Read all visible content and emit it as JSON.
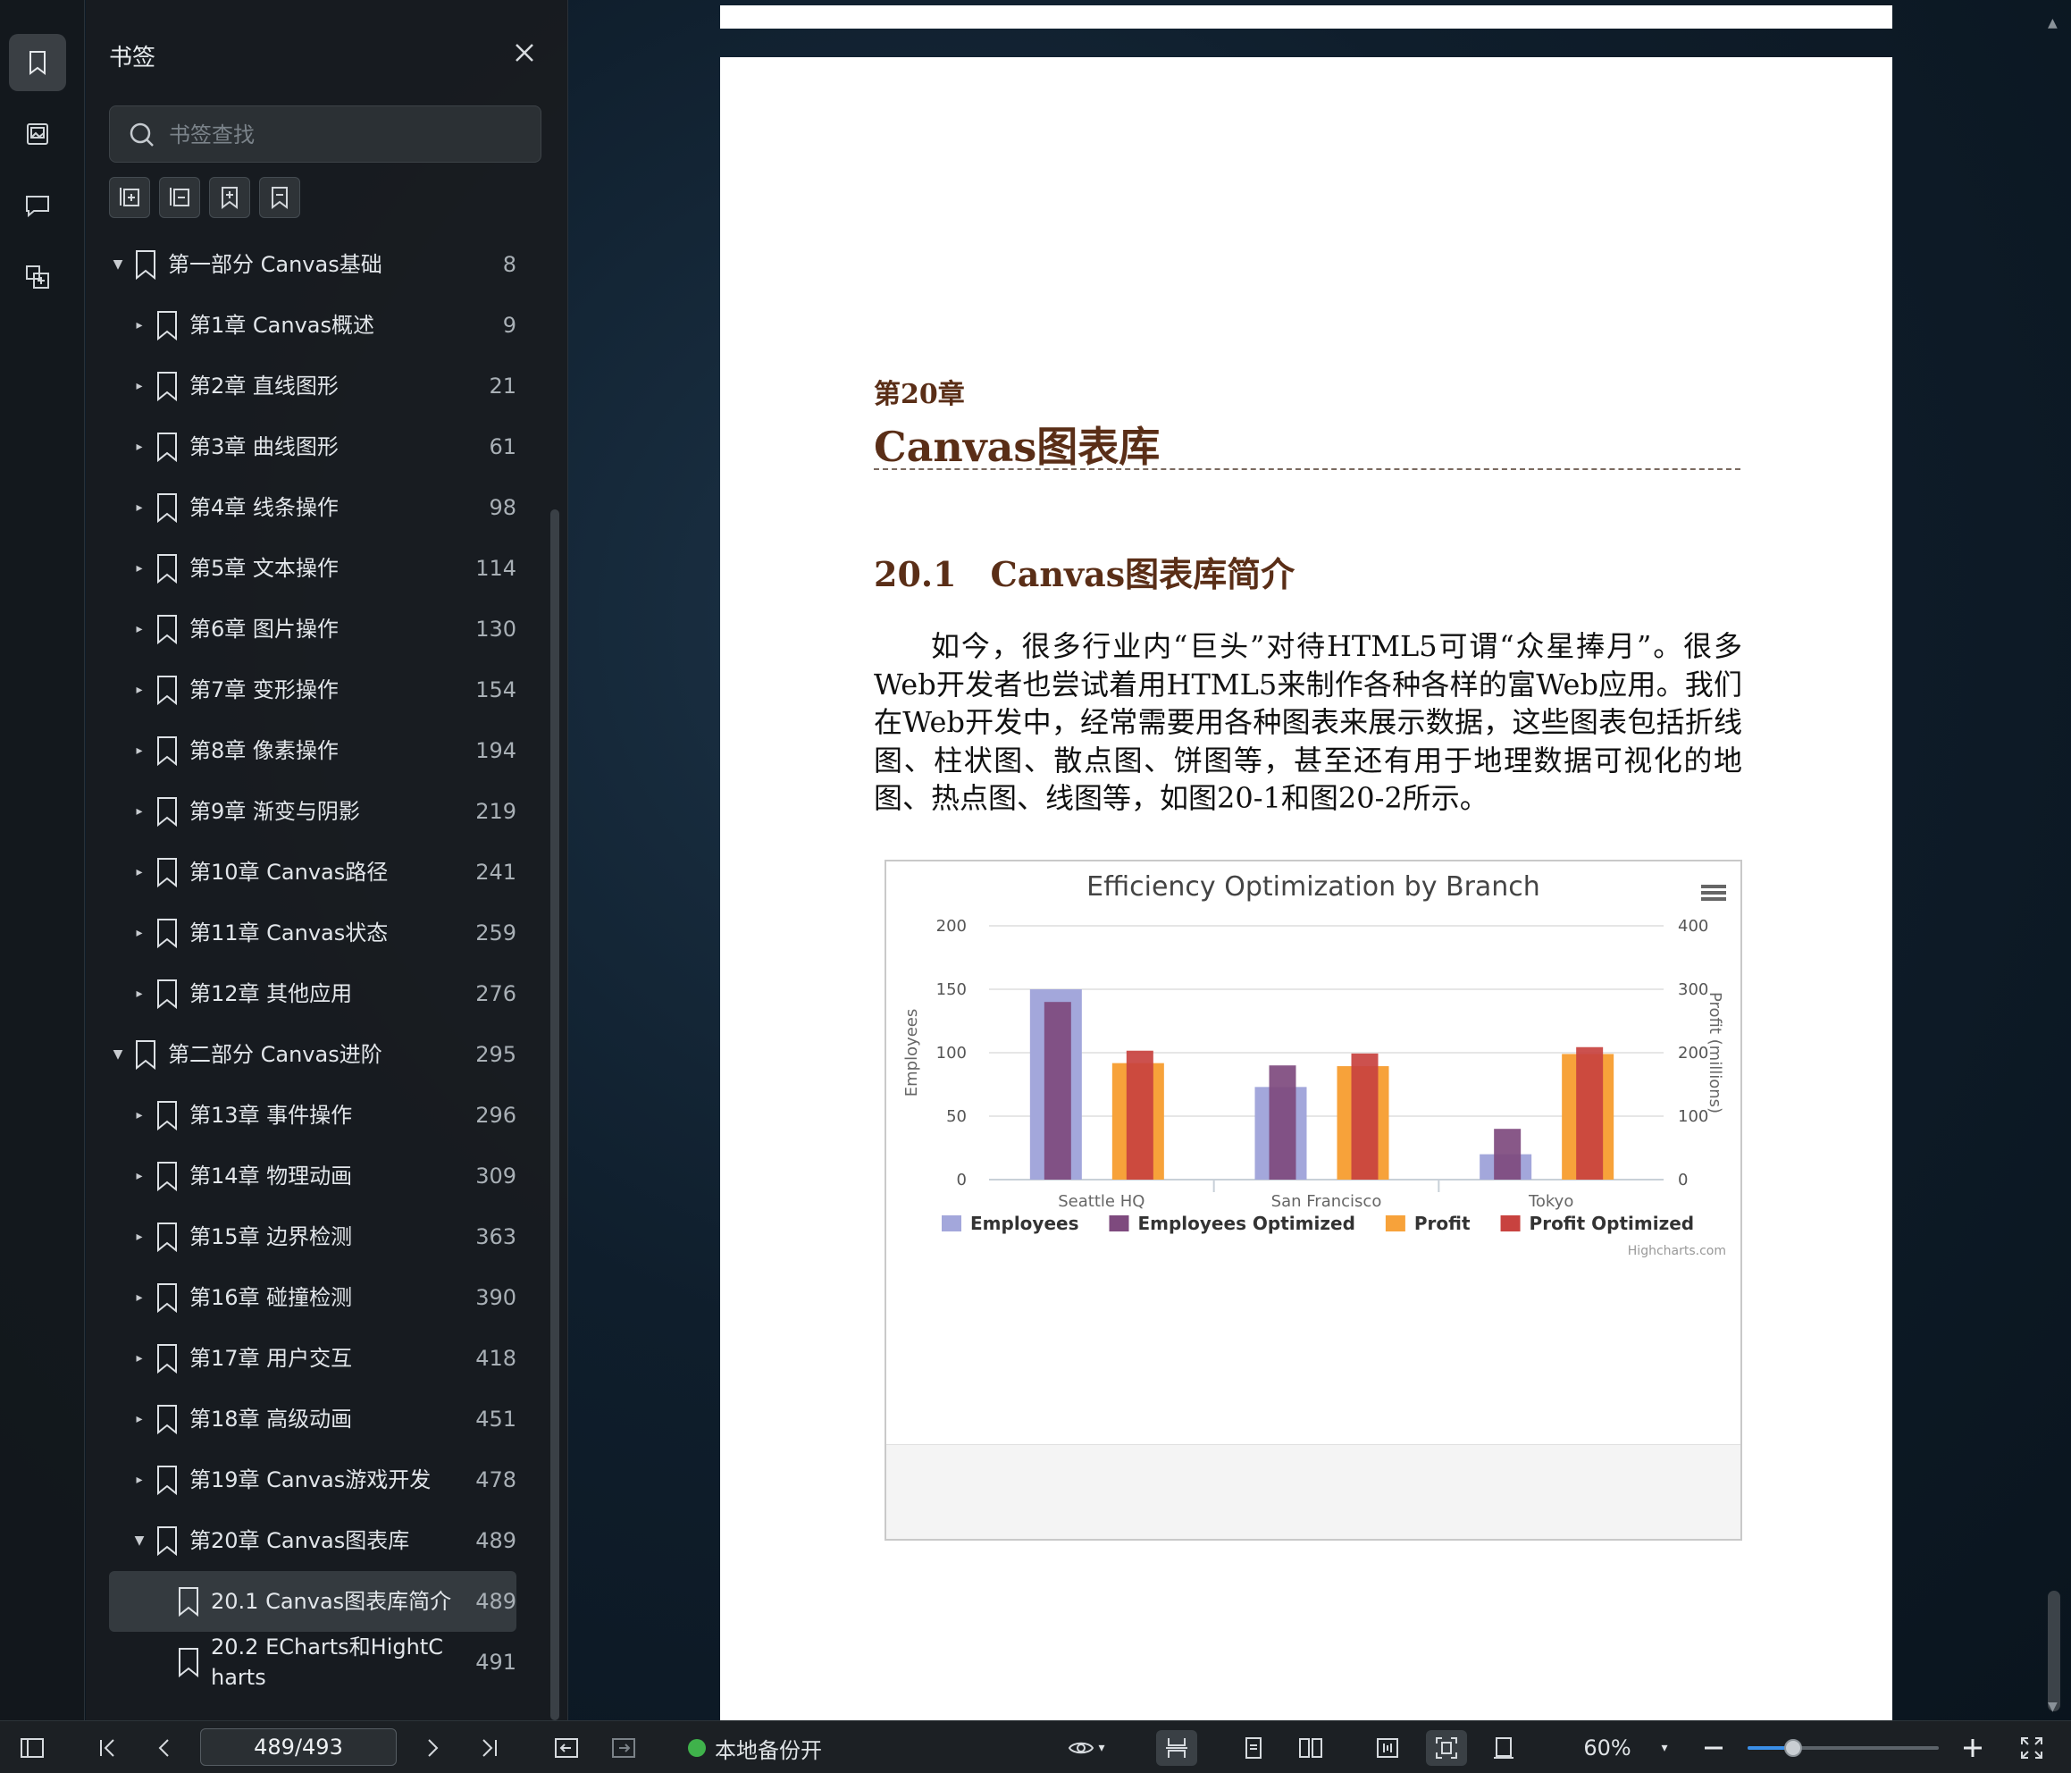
{
  "panel": {
    "title": "书签",
    "search_placeholder": "书签查找"
  },
  "bookmarks": [
    {
      "level": 0,
      "caret": "▼",
      "label": "第一部分 Canvas基础",
      "page": "8"
    },
    {
      "level": 1,
      "caret": "▸",
      "label": "第1章 Canvas概述",
      "page": "9"
    },
    {
      "level": 1,
      "caret": "▸",
      "label": "第2章 直线图形",
      "page": "21"
    },
    {
      "level": 1,
      "caret": "▸",
      "label": "第3章 曲线图形",
      "page": "61"
    },
    {
      "level": 1,
      "caret": "▸",
      "label": "第4章 线条操作",
      "page": "98"
    },
    {
      "level": 1,
      "caret": "▸",
      "label": "第5章 文本操作",
      "page": "114"
    },
    {
      "level": 1,
      "caret": "▸",
      "label": "第6章 图片操作",
      "page": "130"
    },
    {
      "level": 1,
      "caret": "▸",
      "label": "第7章 变形操作",
      "page": "154"
    },
    {
      "level": 1,
      "caret": "▸",
      "label": "第8章 像素操作",
      "page": "194"
    },
    {
      "level": 1,
      "caret": "▸",
      "label": "第9章 渐变与阴影",
      "page": "219"
    },
    {
      "level": 1,
      "caret": "▸",
      "label": "第10章 Canvas路径",
      "page": "241"
    },
    {
      "level": 1,
      "caret": "▸",
      "label": "第11章 Canvas状态",
      "page": "259"
    },
    {
      "level": 1,
      "caret": "▸",
      "label": "第12章 其他应用",
      "page": "276"
    },
    {
      "level": 0,
      "caret": "▼",
      "label": "第二部分 Canvas进阶",
      "page": "295"
    },
    {
      "level": 1,
      "caret": "▸",
      "label": "第13章 事件操作",
      "page": "296"
    },
    {
      "level": 1,
      "caret": "▸",
      "label": "第14章 物理动画",
      "page": "309"
    },
    {
      "level": 1,
      "caret": "▸",
      "label": "第15章 边界检测",
      "page": "363"
    },
    {
      "level": 1,
      "caret": "▸",
      "label": "第16章 碰撞检测",
      "page": "390"
    },
    {
      "level": 1,
      "caret": "▸",
      "label": "第17章 用户交互",
      "page": "418"
    },
    {
      "level": 1,
      "caret": "▸",
      "label": "第18章 高级动画",
      "page": "451"
    },
    {
      "level": 1,
      "caret": "▸",
      "label": "第19章 Canvas游戏开发",
      "page": "478"
    },
    {
      "level": 1,
      "caret": "▼",
      "label": "第20章 Canvas图表库",
      "page": "489"
    },
    {
      "level": 2,
      "caret": "",
      "label": "20.1 Canvas图表库简介",
      "page": "489",
      "selected": true
    },
    {
      "level": 2,
      "caret": "",
      "label": "20.2 ECharts和HightCharts",
      "page": "491"
    }
  ],
  "document": {
    "chapter_number": "第20章",
    "chapter_title": "Canvas图表库",
    "section_title": "20.1　Canvas图表库简介",
    "paragraph": "如今，很多行业内“巨头”对待HTML5可谓“众星捧月”。很多Web开发者也尝试着用HTML5来制作各种各样的富Web应用。我们在Web开发中，经常需要用各种图表来展示数据，这些图表包括折线图、柱状图、散点图、饼图等，甚至还有用于地理数据可视化的地图、热点图、线图等，如图20-1和图20-2所示。"
  },
  "chart_data": {
    "type": "bar",
    "title": "Efficiency Optimization by Branch",
    "categories": [
      "Seattle HQ",
      "San Francisco",
      "Tokyo"
    ],
    "ylabel_left": "Employees",
    "ylabel_right": "Profit (millions)",
    "ylim_left": [
      0,
      200
    ],
    "ylim_right": [
      0,
      400
    ],
    "yticks_left": [
      "0",
      "50",
      "100",
      "150",
      "200"
    ],
    "yticks_right": [
      "0",
      "100",
      "200",
      "300",
      "400"
    ],
    "series": [
      {
        "name": "Employees",
        "axis": "left",
        "color": "#a3a7db",
        "values": [
          150,
          73,
          20
        ]
      },
      {
        "name": "Employees Optimized",
        "axis": "left",
        "color": "#7e4a7e",
        "values": [
          140,
          90,
          40
        ]
      },
      {
        "name": "Profit",
        "axis": "right",
        "color": "#f7a23a",
        "values": [
          183.6,
          178.8,
          198
        ]
      },
      {
        "name": "Profit Optimized",
        "axis": "right",
        "color": "#c8423f",
        "values": [
          203.2,
          198.8,
          208.8
        ]
      }
    ],
    "credit": "Highcharts.com",
    "grid": true,
    "legend": "bottom"
  },
  "status_bar": {
    "page_indicator": "489/493",
    "backup_label": "本地备份开",
    "zoom": "60%",
    "zoom_fraction": 0.24
  },
  "colors": {
    "accent": "#3a8fe8",
    "heading": "#5a2e17",
    "backup_ok": "#3fb24b"
  }
}
